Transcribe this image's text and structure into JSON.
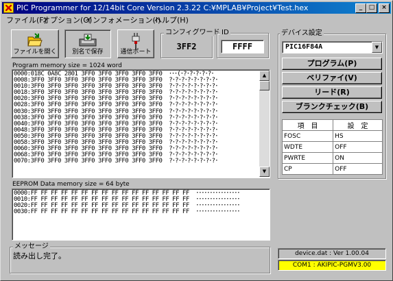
{
  "window": {
    "title": "PIC Programmer for 12/14bit Core Version 2.3.22  C:¥MPLAB¥Project¥Test.hex",
    "minimize": "_",
    "maximize": "□",
    "close": "×"
  },
  "menu": [
    {
      "label": "ファイル(F)"
    },
    {
      "label": "オプション(O)"
    },
    {
      "label": "インフォメーション(I)"
    },
    {
      "label": "ヘルプ(H)"
    }
  ],
  "toolbar": {
    "open_label": "ファイルを開く",
    "save_as_label": "別名で保存",
    "comm_port_label": "通信ポート",
    "open_icon": "folder-open-icon",
    "save_icon": "save-disk-icon",
    "port_icon": "connector-plug-icon"
  },
  "config_word": {
    "legend": "コンフィグワード",
    "value": "3FF2"
  },
  "id": {
    "legend": "ID",
    "value": "FFFF"
  },
  "program_memory": {
    "label": "Program memory size = 1024 word",
    "lines": [
      "0000:018C 0A8C 2801 3FF0 3FF0 3FF0 3FF0 3FF0  ･･･(･?･?･?･?･?･",
      "0008:3FF0 3FF0 3FF0 3FF0 3FF0 3FF0 3FF0 3FF0  ?･?･?･?･?･?･?･?･",
      "0010:3FF0 3FF0 3FF0 3FF0 3FF0 3FF0 3FF0 3FF0  ?･?･?･?･?･?･?･?･",
      "0018:3FF0 3FF0 3FF0 3FF0 3FF0 3FF0 3FF0 3FF0  ?･?･?･?･?･?･?･?･",
      "0020:3FF0 3FF0 3FF0 3FF0 3FF0 3FF0 3FF0 3FF0  ?･?･?･?･?･?･?･?･",
      "0028:3FF0 3FF0 3FF0 3FF0 3FF0 3FF0 3FF0 3FF0  ?･?･?･?･?･?･?･?･",
      "0030:3FF0 3FF0 3FF0 3FF0 3FF0 3FF0 3FF0 3FF0  ?･?･?･?･?･?･?･?･",
      "0038:3FF0 3FF0 3FF0 3FF0 3FF0 3FF0 3FF0 3FF0  ?･?･?･?･?･?･?･?･",
      "0040:3FF0 3FF0 3FF0 3FF0 3FF0 3FF0 3FF0 3FF0  ?･?･?･?･?･?･?･?･",
      "0048:3FF0 3FF0 3FF0 3FF0 3FF0 3FF0 3FF0 3FF0  ?･?･?･?･?･?･?･?･",
      "0050:3FF0 3FF0 3FF0 3FF0 3FF0 3FF0 3FF0 3FF0  ?･?･?･?･?･?･?･?･",
      "0058:3FF0 3FF0 3FF0 3FF0 3FF0 3FF0 3FF0 3FF0  ?･?･?･?･?･?･?･?･",
      "0060:3FF0 3FF0 3FF0 3FF0 3FF0 3FF0 3FF0 3FF0  ?･?･?･?･?･?･?･?･",
      "0068:3FF0 3FF0 3FF0 3FF0 3FF0 3FF0 3FF0 3FF0  ?･?･?･?･?･?･?･?･",
      "0070:3FF0 3FF0 3FF0 3FF0 3FF0 3FF0 3FF0 3FF0  ?･?･?･?･?･?･?･?･"
    ]
  },
  "eeprom": {
    "label": "EEPROM Data memory size = 64 byte",
    "lines": [
      "0000:FF FF FF FF FF FF FF FF FF FF FF FF FF FF FF FF  ････････････････",
      "0010:FF FF FF FF FF FF FF FF FF FF FF FF FF FF FF FF  ････････････････",
      "0020:FF FF FF FF FF FF FF FF FF FF FF FF FF FF FF FF  ････････････････",
      "0030:FF FF FF FF FF FF FF FF FF FF FF FF FF FF FF FF  ････････････････"
    ]
  },
  "device": {
    "legend": "デバイス設定",
    "selected": "PIC16F84A",
    "dropdown_icon": "chevron-down-icon"
  },
  "actions": [
    {
      "label": "プログラム(P)"
    },
    {
      "label": "ベリファイ(V)"
    },
    {
      "label": "リード(R)"
    },
    {
      "label": "ブランクチェック(B)"
    }
  ],
  "config_table": {
    "headers": [
      "項　目",
      "設　定"
    ],
    "rows": [
      {
        "item": "FOSC",
        "value": "HS"
      },
      {
        "item": "WDTE",
        "value": "OFF"
      },
      {
        "item": "PWRTE",
        "value": "ON"
      },
      {
        "item": "CP",
        "value": "OFF"
      }
    ]
  },
  "message": {
    "legend": "メッセージ",
    "text": "読み出し完了。"
  },
  "status": {
    "device_dat": "device.dat : Ver 1.00.04",
    "com": "COM1 : AKIPIC-PGMV3.00",
    "com_bg": "#ffff00"
  }
}
